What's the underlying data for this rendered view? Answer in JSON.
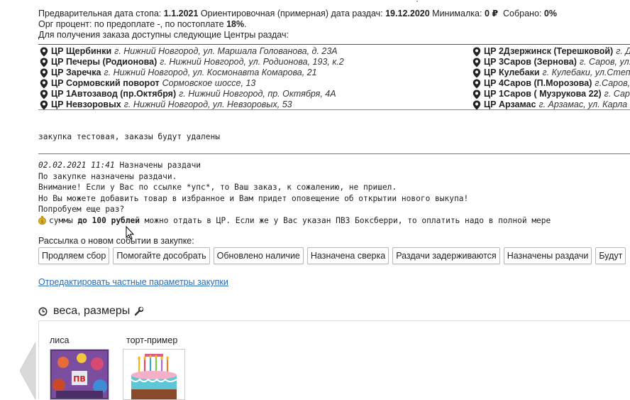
{
  "header_info": {
    "stop_label": "Предварительная дата стопа:",
    "stop_value": "1.1.2021",
    "dist_label": "Ориентировочная (примерная) дата раздач:",
    "dist_value": "19.12.2020",
    "min_label": "Минималка:",
    "min_value": "0 ₽",
    "collected_label": "Собрано:",
    "collected_value": "0%",
    "org_label": "Орг процент: по предоплате -, по постоплате",
    "org_value": "18%",
    "org_suffix": ".",
    "centers_label": "Для получения заказа доступны следующие Центры раздач:"
  },
  "centers_left": [
    {
      "name": "ЦР Щербинки",
      "addr": "г. Нижний Новгород, ул. Маршала Голованова, д. 23А"
    },
    {
      "name": "ЦР Печеры (Родионова)",
      "addr": "г. Нижний Новгород, ул. Родионова, 193, к.2"
    },
    {
      "name": "ЦР Заречка",
      "addr": "г. Нижний Новгород, ул. Космонавта Комарова, 21"
    },
    {
      "name": "ЦР Сормовский поворот",
      "addr": "Сормовское шоссе, 13"
    },
    {
      "name": "ЦР 1Автозавод (пр.Октября)",
      "addr": "г. Нижний Новгород, пр. Октября, 4А"
    },
    {
      "name": "ЦР Невзоровых",
      "addr": "г. Нижний Новгород, ул. Невзоровых, 53"
    }
  ],
  "centers_right": [
    {
      "name": "ЦР 2Дзержинск (Терешковой)",
      "addr": "г. Дзержинск"
    },
    {
      "name": "ЦР 3Саров (Зернова)",
      "addr": "г. Саров, ул. Зернова"
    },
    {
      "name": "ЦР Кулебаки",
      "addr": "г. Кулебаки, ул.Степана Разина"
    },
    {
      "name": "ЦР 4Саров (П.Морозова)",
      "addr": "г.Саров, ул. П.Морозова"
    },
    {
      "name": "ЦР 1Саров ( Музрукова 22)",
      "addr": "г. Саров"
    },
    {
      "name": "ЦР Арзамас",
      "addr": "г. Арзамас, ул. Карла Маркса"
    }
  ],
  "test_note": "закупка тестовая, заказы будут удалены",
  "message": {
    "datetime": "02.02.2021 11:41",
    "title": "Назначены раздачи",
    "line1": "По закупке назначены раздачи.",
    "line2": "Внимание! Если у Вас по ссылке *упс*, то Ваш заказ, к сожалению, не пришел.",
    "line3": "Но Вы можете добавить товар в избранное и Вам придет оповещение об открытии нового выкупа!",
    "line4": "Попробуем еще раз?",
    "line5_prefix": "суммы",
    "line5_bold": "до 100 рублей",
    "line5_suffix": "можно отдать в ЦР. Если же у Вас указан ПВЗ Боксберри, то оплатить надо в полной мере"
  },
  "mailing_label": "Рассылка о новом событии в закупке:",
  "mailing_buttons": [
    "Продляем сбор",
    "Помогайте дособрать",
    "Обновлено наличие",
    "Назначена сверка",
    "Раздачи задерживаются",
    "Назначены раздачи",
    "Будут"
  ],
  "edit_link": "Отредактировать частные параметры закупки",
  "section_title": "веса, размеры",
  "products": [
    {
      "label": "лиса"
    },
    {
      "label": "торт-пример"
    }
  ],
  "colors": {
    "link": "#2a6cb4",
    "pin": "#222222",
    "coin": "#e0b020"
  }
}
